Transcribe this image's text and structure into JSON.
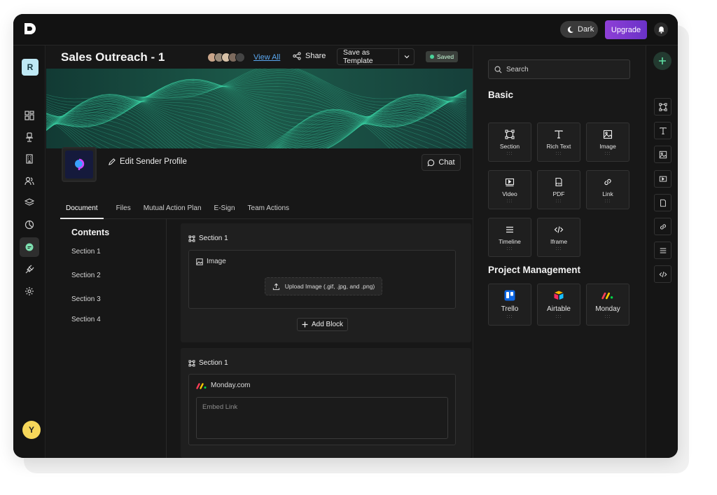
{
  "topbar": {
    "theme_label": "Dark",
    "upgrade_label": "Upgrade"
  },
  "workspace": {
    "badge": "R"
  },
  "user": {
    "initial": "Y"
  },
  "document": {
    "title": "Sales Outreach - 1",
    "view_all": "View All",
    "share": "Share",
    "save_template": "Save as Template",
    "status": "Saved",
    "edit_profile": "Edit Sender Profile",
    "chat": "Chat"
  },
  "tabs": [
    "Document",
    "Files",
    "Mutual Action Plan",
    "E-Sign",
    "Team Actions"
  ],
  "contents": {
    "title": "Contents",
    "items": [
      "Section 1",
      "Section 2",
      "Section 3",
      "Section 4"
    ]
  },
  "sections": [
    {
      "title": "Section 1",
      "block_label": "Image",
      "upload_label": "Upload Image (.gif, .jpg, and .png)",
      "add_block": "Add Block"
    },
    {
      "title": "Section 1",
      "block_label": "Monday.com",
      "embed_placeholder": "Embed Link"
    }
  ],
  "panel": {
    "search_placeholder": "Search",
    "basic_heading": "Basic",
    "basic_items": [
      "Section",
      "Rich Text",
      "Image",
      "Video",
      "PDF",
      "Link",
      "Timeline",
      "Iframe"
    ],
    "pm_heading": "Project Management",
    "pm_items": [
      "Trello",
      "Airtable",
      "Monday"
    ]
  },
  "colors": {
    "accent": "#8e3fd6",
    "saved_dot": "#4ad39a",
    "link": "#5aa7f0"
  }
}
